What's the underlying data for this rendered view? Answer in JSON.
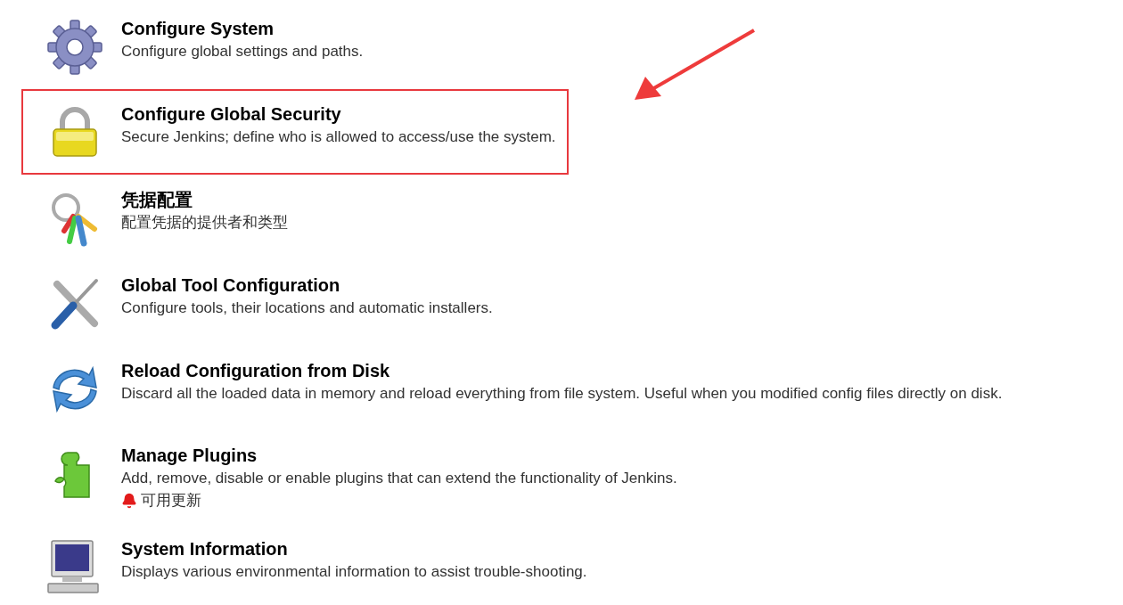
{
  "items": [
    {
      "kind": "gear",
      "title": "Configure System",
      "description": "Configure global settings and paths.",
      "highlighted": false
    },
    {
      "kind": "lock",
      "title": "Configure Global Security",
      "description": "Secure Jenkins; define who is allowed to access/use the system.",
      "highlighted": true
    },
    {
      "kind": "keys",
      "title": "凭据配置",
      "description": "配置凭据的提供者和类型",
      "highlighted": false
    },
    {
      "kind": "tools",
      "title": "Global Tool Configuration",
      "description": "Configure tools, their locations and automatic installers.",
      "highlighted": false
    },
    {
      "kind": "reload",
      "title": "Reload Configuration from Disk",
      "description": "Discard all the loaded data in memory and reload everything from file system. Useful when you modified config files directly on disk.",
      "highlighted": false
    },
    {
      "kind": "plugin",
      "title": "Manage Plugins",
      "description": "Add, remove, disable or enable plugins that can extend the functionality of Jenkins.",
      "notice": "可用更新",
      "highlighted": false
    },
    {
      "kind": "computer",
      "title": "System Information",
      "description": "Displays various environmental information to assist trouble-shooting.",
      "highlighted": false
    }
  ]
}
